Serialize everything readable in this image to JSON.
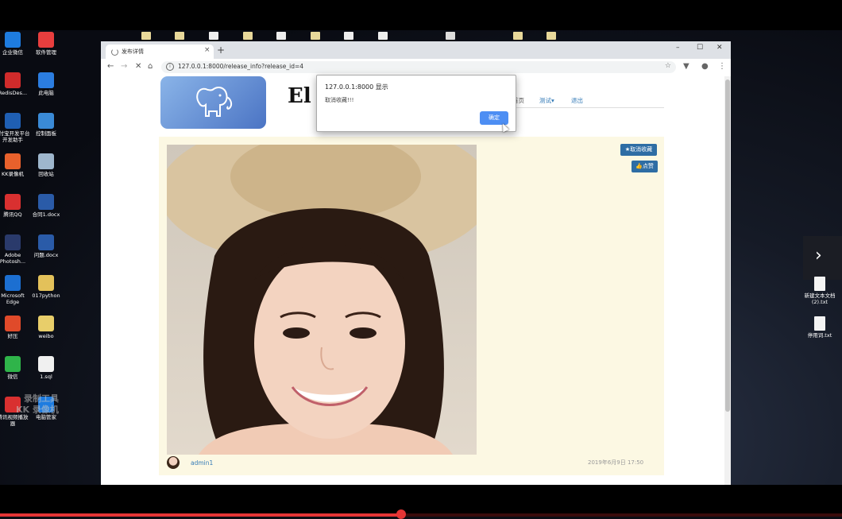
{
  "desktop": {
    "left_icons": [
      {
        "name": "qiye-weixin",
        "label": "企业微信",
        "color": "#1e7ce0"
      },
      {
        "name": "ruanjian-guanli",
        "label": "软件管理",
        "color": "#e83e3e"
      },
      {
        "name": "redis-desktop",
        "label": "RedisDes...",
        "color": "#d02b2b"
      },
      {
        "name": "ci-diannao",
        "label": "此电脑",
        "color": "#2b7de0"
      },
      {
        "name": "e-fuzhan",
        "label": "E付宝开发平台开发助手",
        "color": "#1f5fb3"
      },
      {
        "name": "kongzhi-mianban",
        "label": "控制面板",
        "color": "#3a8ad6"
      },
      {
        "name": "kk-luxiangji",
        "label": "KK录像机",
        "color": "#e8612c"
      },
      {
        "name": "huishouzhan",
        "label": "回收站",
        "color": "#9eb6cc"
      },
      {
        "name": "tengxun-qq",
        "label": "腾讯QQ",
        "color": "#d93030"
      },
      {
        "name": "hetong-docx",
        "label": "合同1.docx",
        "color": "#2a5ba8"
      },
      {
        "name": "adobe-photoshop",
        "label": "Adobe Photosh...",
        "color": "#2a3a6b"
      },
      {
        "name": "wenti-docx",
        "label": "问题.docx",
        "color": "#2a5ba8"
      },
      {
        "name": "microsoft-edge",
        "label": "Microsoft Edge",
        "color": "#1c6fd1"
      },
      {
        "name": "017python",
        "label": "017python",
        "color": "#e3c15a"
      },
      {
        "name": "haoya",
        "label": "好压",
        "color": "#e04a2a"
      },
      {
        "name": "weibo",
        "label": "weibo",
        "color": "#e8ce6a"
      },
      {
        "name": "weixin",
        "label": "微信",
        "color": "#2fb44a"
      },
      {
        "name": "1-sql",
        "label": "1.sql",
        "color": "#f0f0f0"
      },
      {
        "name": "kk-shipin",
        "label": "腾讯视频播放器",
        "color": "#d93030"
      },
      {
        "name": "diannao-guanjia",
        "label": "电脑管家",
        "color": "#1e7ce0"
      }
    ],
    "right_files": [
      {
        "label": "新建文本文档 (2).txt"
      },
      {
        "label": "停用词.txt"
      }
    ],
    "watermark_line1": "录制工具",
    "watermark_line2": "KK 录像机"
  },
  "browser": {
    "tab_title": "发布详情",
    "tab_close": "×",
    "new_tab": "+",
    "url": "127.0.0.1:8000/release_info?release_id=4",
    "win_min": "–",
    "win_max": "☐",
    "win_close": "✕"
  },
  "site": {
    "title": "El",
    "nav": [
      {
        "label": "首页"
      },
      {
        "label": "测试▾"
      },
      {
        "label": "退出"
      }
    ]
  },
  "post": {
    "fav_button": "★取消收藏",
    "like_button": "👍点赞",
    "author": "admin1",
    "date": "2019年6月9日 17:50"
  },
  "dialog": {
    "title": "127.0.0.1:8000 显示",
    "message": "取消收藏!!!",
    "ok": "确定"
  }
}
